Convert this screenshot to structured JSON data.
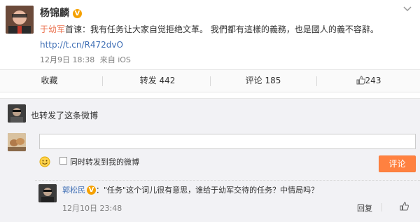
{
  "post": {
    "author": "杨锦麟",
    "verified_badge": "V",
    "mention": "于幼军",
    "text_after_mention": "首谏：我有任务让大家自觉拒绝文革。 我們都有這樣的義務，也是國人的義不容辭。",
    "short_link": "http://t.cn/R472dvO",
    "timestamp": "12月9日 18:38",
    "source": "来自 iOS",
    "menu_icon": "chevron-down-icon"
  },
  "actions": {
    "favorite": "收藏",
    "repost": "转发 442",
    "comment": "评论 185",
    "like_icon": "thumbs-up-icon",
    "like_count": "243"
  },
  "repost_notice": {
    "text": "也转发了这条微博"
  },
  "composer": {
    "input_value": "",
    "emoji_icon": "smiley-icon",
    "also_repost_label": "同时转发到我的微博",
    "submit_label": "评论"
  },
  "comment": {
    "author": "郭松民",
    "verified_badge": "V",
    "text": "：\"任务\"这个词儿很有意思，谁给于幼军交待的任务？中情局吗？",
    "timestamp": "12月10日 23:48",
    "reply_label": "回复",
    "like_icon": "thumbs-up-icon"
  },
  "colors": {
    "accent_orange": "#eb7350",
    "link_blue": "#3f6fb5",
    "button_orange": "#ff8140",
    "badge_gold": "#f5a100"
  }
}
